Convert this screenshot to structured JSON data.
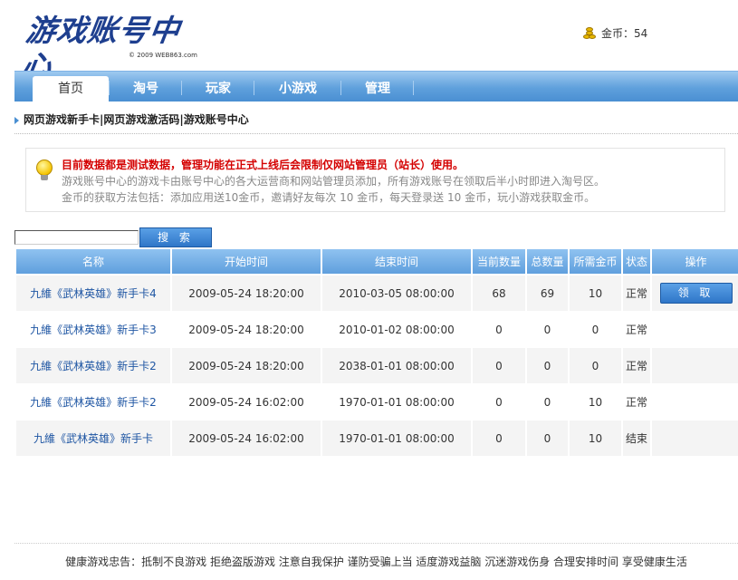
{
  "header": {
    "logo_text": "游戏账号中心",
    "logo_sub": "© 2009 WEB863.com",
    "coins_label": "金币：54"
  },
  "nav": {
    "items": [
      {
        "label": "首页",
        "active": true
      },
      {
        "label": "淘号"
      },
      {
        "label": "玩家"
      },
      {
        "label": "小游戏"
      },
      {
        "label": "管理"
      }
    ]
  },
  "breadcrumb": "网页游戏新手卡|网页游戏激活码|游戏账号中心",
  "notice": {
    "red": "目前数据都是测试数据，管理功能在正式上线后会限制仅网站管理员（站长）使用。",
    "line1": "游戏账号中心的游戏卡由账号中心的各大运营商和网站管理员添加，所有游戏账号在领取后半小时即进入淘号区。",
    "line2": "金币的获取方法包括：添加应用送10金币，邀请好友每次 10 金币，每天登录送 10 金币，玩小游戏获取金币。"
  },
  "search": {
    "value": "",
    "button_label": "搜 索"
  },
  "table": {
    "headers": [
      "名称",
      "开始时间",
      "结束时间",
      "当前数量",
      "总数量",
      "所需金币",
      "状态",
      "操作"
    ],
    "rows": [
      {
        "name": "九維《武林英雄》新手卡4",
        "start": "2009-05-24 18:20:00",
        "end": "2010-03-05 08:00:00",
        "current": "68",
        "total": "69",
        "coins": "10",
        "status": "正常",
        "action": "领 取"
      },
      {
        "name": "九維《武林英雄》新手卡3",
        "start": "2009-05-24 18:20:00",
        "end": "2010-01-02 08:00:00",
        "current": "0",
        "total": "0",
        "coins": "0",
        "status": "正常",
        "action": ""
      },
      {
        "name": "九維《武林英雄》新手卡2",
        "start": "2009-05-24 18:20:00",
        "end": "2038-01-01 08:00:00",
        "current": "0",
        "total": "0",
        "coins": "0",
        "status": "正常",
        "action": ""
      },
      {
        "name": "九維《武林英雄》新手卡2",
        "start": "2009-05-24 16:02:00",
        "end": "1970-01-01 08:00:00",
        "current": "0",
        "total": "0",
        "coins": "10",
        "status": "正常",
        "action": ""
      },
      {
        "name": "九維《武林英雄》新手卡",
        "start": "2009-05-24 16:02:00",
        "end": "1970-01-01 08:00:00",
        "current": "0",
        "total": "0",
        "coins": "10",
        "status": "结束",
        "action": ""
      }
    ]
  },
  "footer": "健康游戏忠告：抵制不良游戏 拒绝盗版游戏 注意自我保护 谨防受骗上当 适度游戏益脑 沉迷游戏伤身 合理安排时间 享受健康生活",
  "colors": {
    "nav_blue": "#5fa0dc",
    "link_blue": "#1f56a3",
    "notice_red": "#d40000"
  }
}
